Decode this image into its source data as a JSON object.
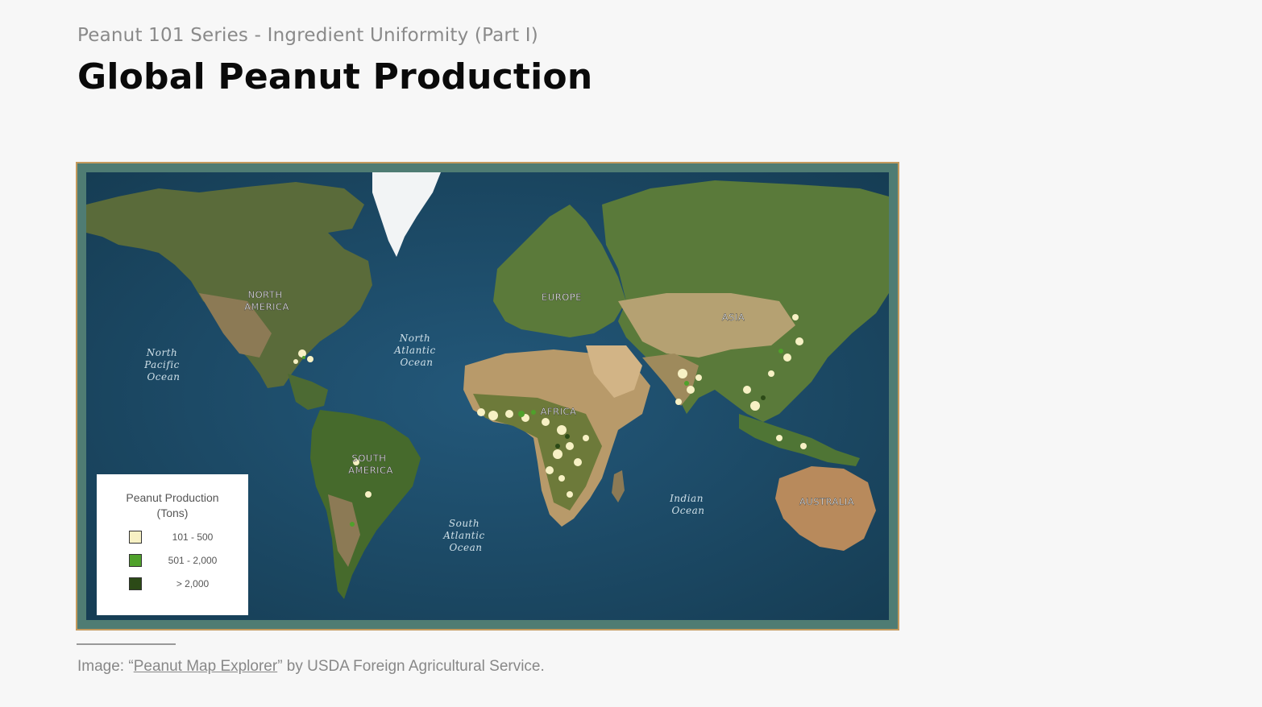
{
  "header": {
    "subtitle": "Peanut 101 Series - Ingredient Uniformity (Part I)",
    "title": "Global Peanut Production"
  },
  "map": {
    "continent_labels": {
      "north_america": [
        "NORTH",
        "AMERICA"
      ],
      "europe": "EUROPE",
      "asia": "ASIA",
      "africa": "AFRICA",
      "south_america": [
        "SOUTH",
        "AMERICA"
      ],
      "australia": "AUSTRALIA"
    },
    "ocean_labels": {
      "north_pacific": [
        "North",
        "Pacific",
        "Ocean"
      ],
      "north_atlantic": [
        "North",
        "Atlantic",
        "Ocean"
      ],
      "south_atlantic": [
        "South",
        "Atlantic",
        "Ocean"
      ],
      "indian": [
        "Indian",
        "Ocean"
      ]
    },
    "legend": {
      "title_line1": "Peanut Production",
      "title_line2": "(Tons)",
      "classes": [
        {
          "label": "101 - 500",
          "color": "#f7f1c4"
        },
        {
          "label": "501 - 2,000",
          "color": "#4fa12b"
        },
        {
          "label": "> 2,000",
          "color": "#2c4a17"
        }
      ]
    },
    "colors": {
      "ocean": "#1f4d66",
      "frame": "#4f7c73",
      "frame_border": "#c49a5d"
    }
  },
  "caption": {
    "prefix": "Image: “",
    "link_text": "Peanut Map Explorer",
    "suffix": "” by USDA Foreign Agricultural Service."
  }
}
